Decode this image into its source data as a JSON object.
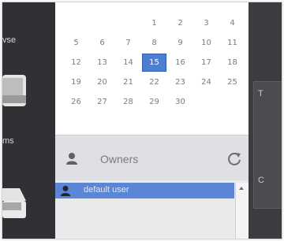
{
  "sidebar": {
    "browse_label": "vse",
    "items_label": "ms"
  },
  "calendar": {
    "rows": [
      [
        "",
        "",
        "",
        "1",
        "2",
        "3",
        "4"
      ],
      [
        "5",
        "6",
        "7",
        "8",
        "9",
        "10",
        "11"
      ],
      [
        "12",
        "13",
        "14",
        "15",
        "16",
        "17",
        "18"
      ],
      [
        "19",
        "20",
        "21",
        "22",
        "23",
        "24",
        "25"
      ],
      [
        "26",
        "27",
        "28",
        "29",
        "30",
        "",
        ""
      ]
    ],
    "selected_day": "15"
  },
  "owners": {
    "title": "Owners",
    "list": [
      {
        "name": "default user"
      }
    ]
  },
  "right_panel": {
    "text1": "T",
    "text2": "",
    "text3": "C"
  },
  "colors": {
    "selected": "#4d7fd1",
    "row_selected": "#5b86d6",
    "sidebar_bg": "#2f3134"
  }
}
